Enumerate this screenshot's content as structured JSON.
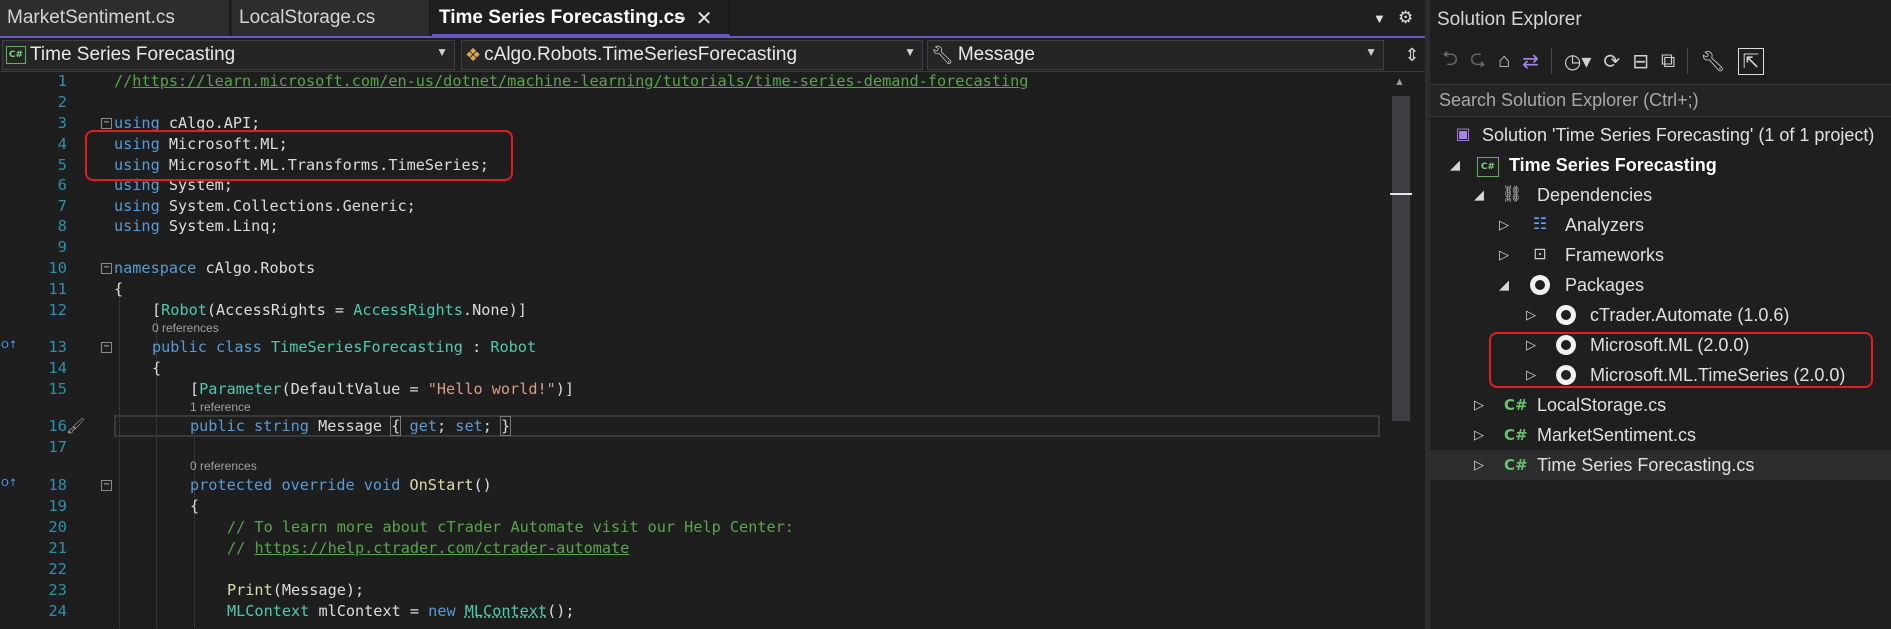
{
  "tabs": [
    {
      "label": "MarketSentiment.cs",
      "active": false
    },
    {
      "label": "LocalStorage.cs",
      "active": false
    },
    {
      "label": "Time Series Forecasting.cs",
      "active": true
    }
  ],
  "tab_icons": {
    "pin": "pin-icon",
    "close": "close-icon",
    "overflow": "chevron-down-icon",
    "settings": "gear-icon"
  },
  "navbar": {
    "project": "Time Series Forecasting",
    "type": "cAlgo.Robots.TimeSeriesForecasting",
    "member": "Message"
  },
  "code": {
    "line_numbers": [
      "1",
      "2",
      "3",
      "4",
      "5",
      "6",
      "7",
      "8",
      "9",
      "10",
      "11",
      "12",
      "13",
      "14",
      "15",
      "16",
      "17",
      "18",
      "19",
      "20",
      "21",
      "22",
      "23",
      "24"
    ],
    "l1_comment": "//",
    "l1_url": "https://learn.microsoft.com/en-us/dotnet/machine-learning/tutorials/time-series-demand-forecasting",
    "using": "using",
    "l3_ns": "cAlgo.API;",
    "l4_ns": "Microsoft.ML;",
    "l5_ns": "Microsoft.ML.Transforms.TimeSeries;",
    "l6_ns": "System;",
    "l7_ns": "System.Collections.Generic;",
    "l8_ns": "System.Linq;",
    "namespace_kw": "namespace",
    "l10_ns": "cAlgo.Robots",
    "open_brace": "{",
    "l12_open": "[",
    "l12_attr": "Robot",
    "l12_mid": "(AccessRights = ",
    "l12_type": "AccessRights",
    "l12_end": ".None)]",
    "refs_0": "0 references",
    "refs_1": "1 reference",
    "refs_0b": "0 references",
    "l13_public": "public",
    "l13_class": "class",
    "l13_name": "TimeSeriesForecasting",
    "l13_colon": " : ",
    "l13_base": "Robot",
    "l15_open": "[",
    "l15_attr": "Parameter",
    "l15_mid": "(DefaultValue = ",
    "l15_str": "\"Hello world!\"",
    "l15_end": ")]",
    "l16_public": "public",
    "l16_string": "string",
    "l16_name": "Message",
    "l16_open": "{",
    "l16_get": "get",
    "l16_set": "set",
    "l16_close": "}",
    "semi": ";",
    "l18_protected": "protected",
    "l18_override": "override",
    "l18_void": "void",
    "l18_method": "OnStart",
    "l18_parens": "()",
    "l20_comment": "// To learn more about cTrader Automate visit our Help Center:",
    "l21_prefix": "// ",
    "l21_url": "https://help.ctrader.com/ctrader-automate",
    "l23_print": "Print",
    "l23_args": "(Message);",
    "l24_type": "MLContext",
    "l24_var": " mlContext = ",
    "l24_new": "new",
    "l24_ctor": "MLContext",
    "l24_end": "();"
  },
  "solution_explorer": {
    "title": "Solution Explorer",
    "search_placeholder": "Search Solution Explorer (Ctrl+;)",
    "toolbar_icons": [
      "back-icon",
      "forward-icon",
      "home-icon",
      "switch-views-icon",
      "history-icon",
      "sync-icon",
      "collapse-all-icon",
      "show-all-files-icon",
      "properties-icon",
      "preview-icon"
    ],
    "tree": {
      "solution": "Solution 'Time Series Forecasting' (1 of 1 project)",
      "project": "Time Series Forecasting",
      "dependencies": "Dependencies",
      "analyzers": "Analyzers",
      "frameworks": "Frameworks",
      "packages": "Packages",
      "pkg1": "cTrader.Automate (1.0.6)",
      "pkg2": "Microsoft.ML (2.0.0)",
      "pkg3": "Microsoft.ML.TimeSeries (2.0.0)",
      "file1": "LocalStorage.cs",
      "file2": "MarketSentiment.cs",
      "file3": "Time Series Forecasting.cs"
    },
    "cs_label": "C#"
  },
  "colors": {
    "accent": "#6d57c7",
    "highlight_box": "#e01e1e",
    "keyword": "#569cd6",
    "type": "#4ec9b0",
    "comment": "#57a64a",
    "string": "#d69d85"
  }
}
